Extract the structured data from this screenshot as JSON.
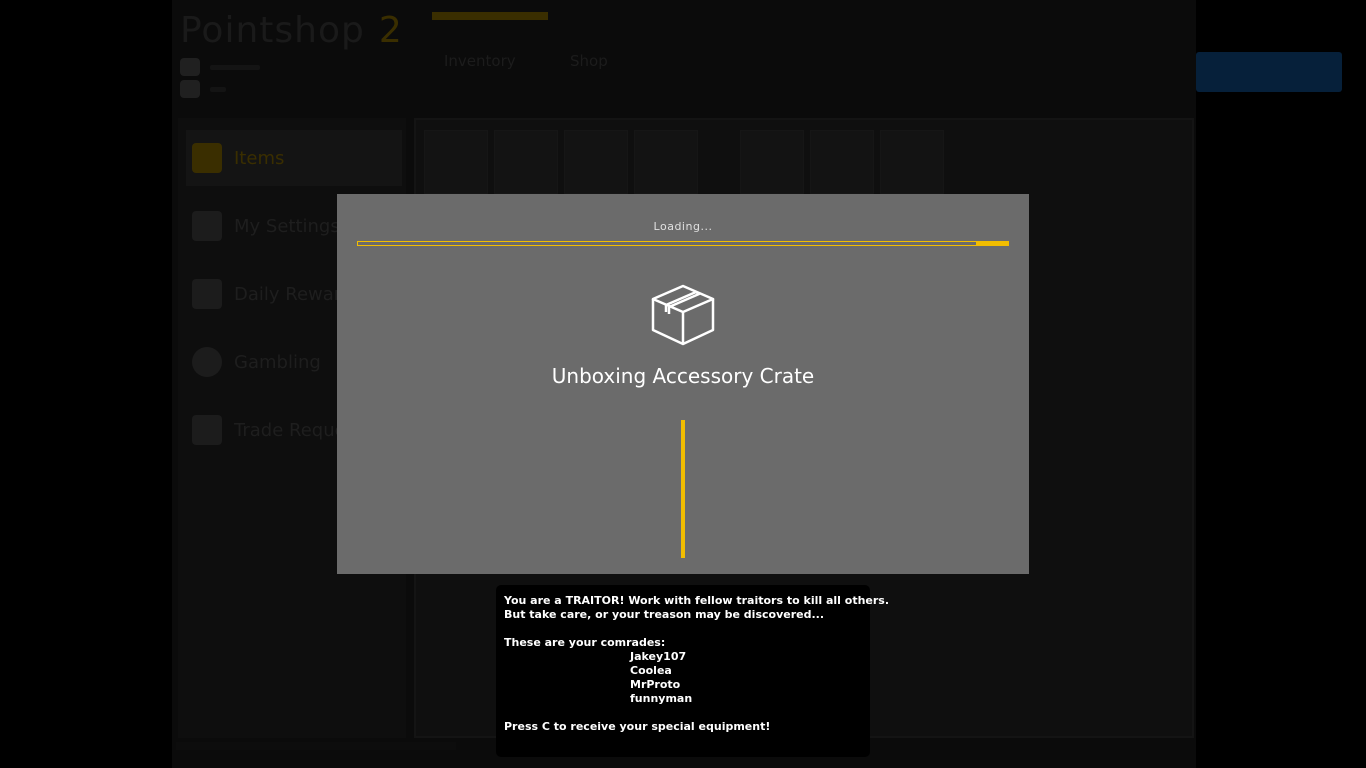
{
  "background_shop": {
    "logo_text": "Pointshop",
    "logo_number": "2",
    "tabs": [
      "Inventory",
      "Shop"
    ],
    "sidebar_items": [
      {
        "label": "Items",
        "active": true
      },
      {
        "label": "My Settings",
        "active": false
      },
      {
        "label": "Daily Rewards",
        "active": false
      },
      {
        "label": "Gambling",
        "active": false
      },
      {
        "label": "Trade Requests",
        "active": false
      }
    ],
    "accent_color": "#f2bd00",
    "button_color": "#0a5aa0"
  },
  "unbox": {
    "loading_text": "Loading...",
    "progress": 0.95,
    "icon": "box-icon",
    "title": "Unboxing Accessory Crate",
    "accent_color": "#f2bd00"
  },
  "traitor_message": {
    "line1": "You are a TRAITOR! Work with fellow traitors to kill all others.",
    "line2": "But take care, or your treason may be discovered...",
    "comrades_heading": "These are your comrades:",
    "comrades": [
      "Jakey107",
      "Coolea",
      "MrProto",
      "funnyman"
    ],
    "footer": "Press C to receive your special equipment!"
  }
}
